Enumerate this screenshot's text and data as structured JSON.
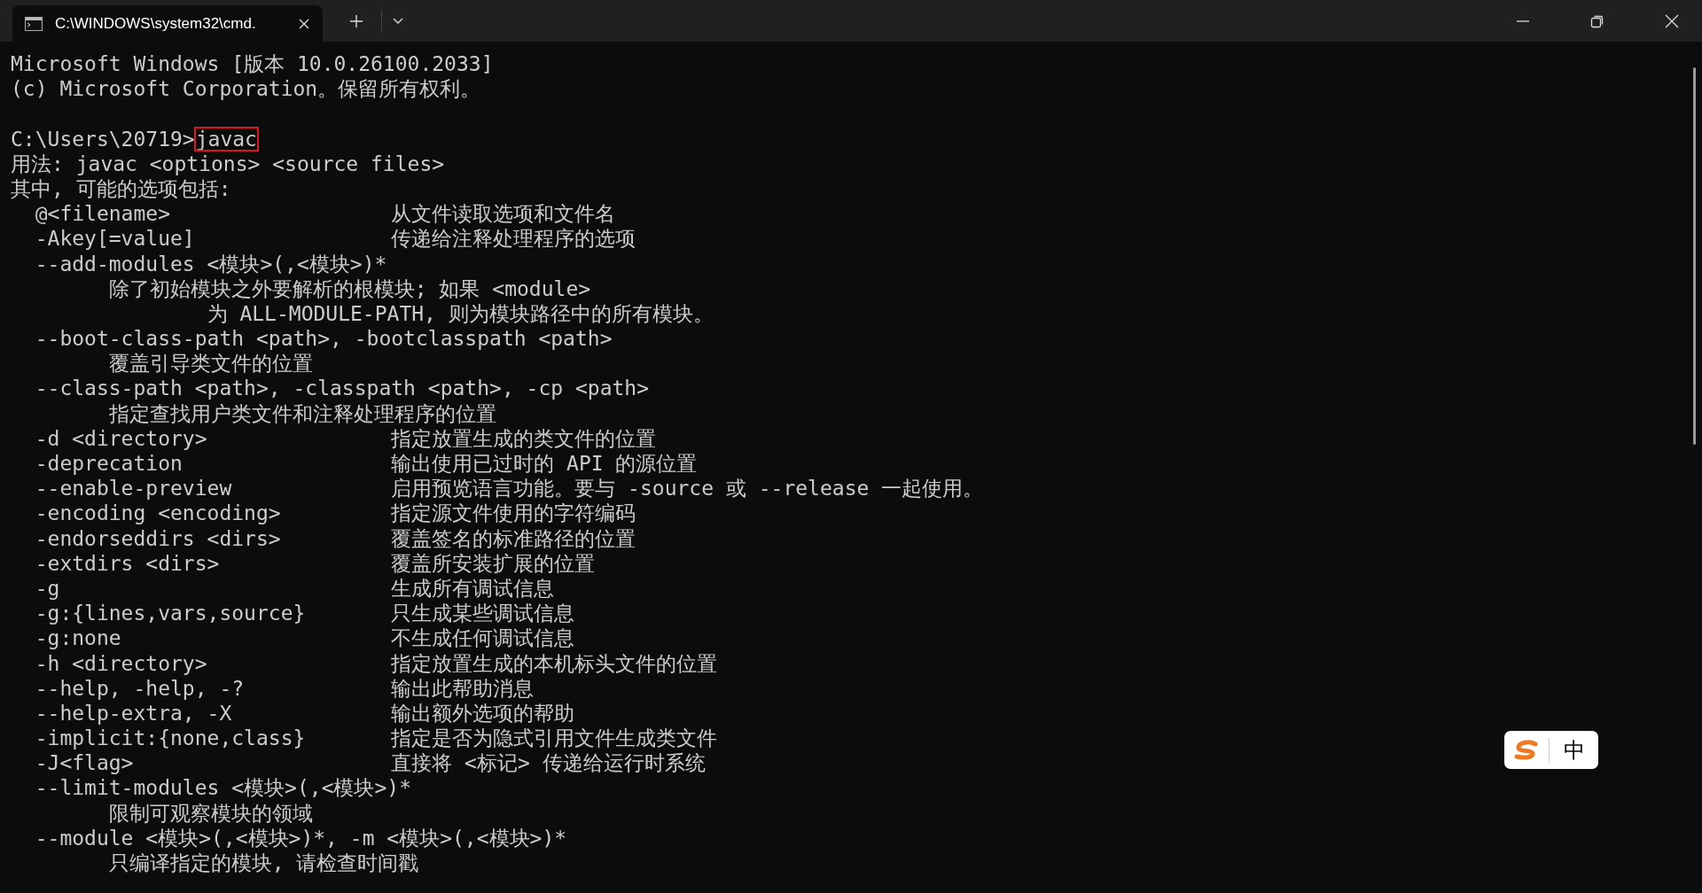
{
  "window": {
    "tab_title": "C:\\WINDOWS\\system32\\cmd.",
    "tab_selected": true
  },
  "console": [
    {
      "kind": "line",
      "text": "Microsoft Windows [版本 10.0.26100.2033]"
    },
    {
      "kind": "line",
      "text": "(c) Microsoft Corporation。保留所有权利。"
    },
    {
      "kind": "blank"
    },
    {
      "kind": "prompt",
      "prompt": "C:\\Users\\20719>",
      "command": "javac",
      "highlighted": true
    },
    {
      "kind": "line",
      "text": "用法: javac <options> <source files>"
    },
    {
      "kind": "line",
      "text": "其中, 可能的选项包括:"
    },
    {
      "kind": "option",
      "option": "@<filename>",
      "description": "从文件读取选项和文件名"
    },
    {
      "kind": "option",
      "option": "-Akey[=value]",
      "description": "传递给注释处理程序的选项"
    },
    {
      "kind": "option",
      "option": "--add-modules <模块>(,<模块>)*"
    },
    {
      "kind": "detail",
      "text": "除了初始模块之外要解析的根模块; 如果 <module>"
    },
    {
      "kind": "continuation",
      "text": "为 ALL-MODULE-PATH, 则为模块路径中的所有模块。"
    },
    {
      "kind": "option",
      "option": "--boot-class-path <path>, -bootclasspath <path>"
    },
    {
      "kind": "detail",
      "text": "覆盖引导类文件的位置"
    },
    {
      "kind": "option",
      "option": "--class-path <path>, -classpath <path>, -cp <path>"
    },
    {
      "kind": "detail",
      "text": "指定查找用户类文件和注释处理程序的位置"
    },
    {
      "kind": "option",
      "option": "-d <directory>",
      "description": "指定放置生成的类文件的位置"
    },
    {
      "kind": "option",
      "option": "-deprecation",
      "description": "输出使用已过时的 API 的源位置"
    },
    {
      "kind": "option",
      "option": "--enable-preview",
      "description": "启用预览语言功能。要与 -source 或 --release 一起使用。"
    },
    {
      "kind": "option",
      "option": "-encoding <encoding>",
      "description": "指定源文件使用的字符编码"
    },
    {
      "kind": "option",
      "option": "-endorseddirs <dirs>",
      "description": "覆盖签名的标准路径的位置"
    },
    {
      "kind": "option",
      "option": "-extdirs <dirs>",
      "description": "覆盖所安装扩展的位置"
    },
    {
      "kind": "option",
      "option": "-g",
      "description": "生成所有调试信息"
    },
    {
      "kind": "option",
      "option": "-g:{lines,vars,source}",
      "description": "只生成某些调试信息"
    },
    {
      "kind": "option",
      "option": "-g:none",
      "description": "不生成任何调试信息"
    },
    {
      "kind": "option",
      "option": "-h <directory>",
      "description": "指定放置生成的本机标头文件的位置"
    },
    {
      "kind": "option",
      "option": "--help, -help, -?",
      "description": "输出此帮助消息"
    },
    {
      "kind": "option",
      "option": "--help-extra, -X",
      "description": "输出额外选项的帮助"
    },
    {
      "kind": "option",
      "option": "-implicit:{none,class}",
      "description": "指定是否为隐式引用文件生成类文件"
    },
    {
      "kind": "option",
      "option": "-J<flag>",
      "description": "直接将 <标记> 传递给运行时系统"
    },
    {
      "kind": "option",
      "option": "--limit-modules <模块>(,<模块>)*"
    },
    {
      "kind": "detail",
      "text": "限制可观察模块的领域"
    },
    {
      "kind": "option",
      "option": "--module <模块>(,<模块>)*, -m <模块>(,<模块>)*"
    },
    {
      "kind": "detail",
      "text": "只编译指定的模块, 请检查时间戳"
    }
  ],
  "ime": {
    "mode": "中"
  }
}
